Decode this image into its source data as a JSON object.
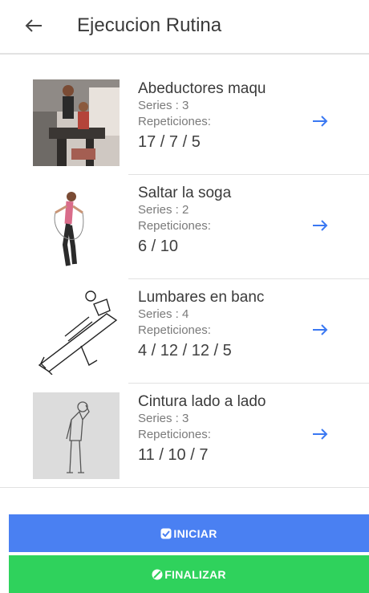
{
  "header": {
    "title": "Ejecucion Rutina",
    "back_icon": "arrow-left-icon"
  },
  "exercises": [
    {
      "name": "Abeductores maqu",
      "series": "Series : 3",
      "rep_label": "Repeticiones:",
      "reps": "17 / 7 / 5",
      "image": "gym-machine-photo"
    },
    {
      "name": "Saltar la soga",
      "series": "Series : 2",
      "rep_label": "Repeticiones:",
      "reps": "6 / 10",
      "image": "jump-rope-illustration"
    },
    {
      "name": "Lumbares en banc",
      "series": "Series : 4",
      "rep_label": "Repeticiones:",
      "reps": "4 / 12 / 12 / 5",
      "image": "back-extension-bench-sketch"
    },
    {
      "name": "Cintura lado a lado",
      "series": "Series : 3",
      "rep_label": "Repeticiones:",
      "reps": "11 / 10 / 7",
      "image": "waist-side-bend-figure"
    }
  ],
  "buttons": {
    "start": "INICIAR",
    "finish": "FINALIZAR"
  },
  "colors": {
    "accent_blue": "#4a80f2",
    "accent_green": "#2fd25c",
    "arrow_blue": "#3a78f2"
  }
}
